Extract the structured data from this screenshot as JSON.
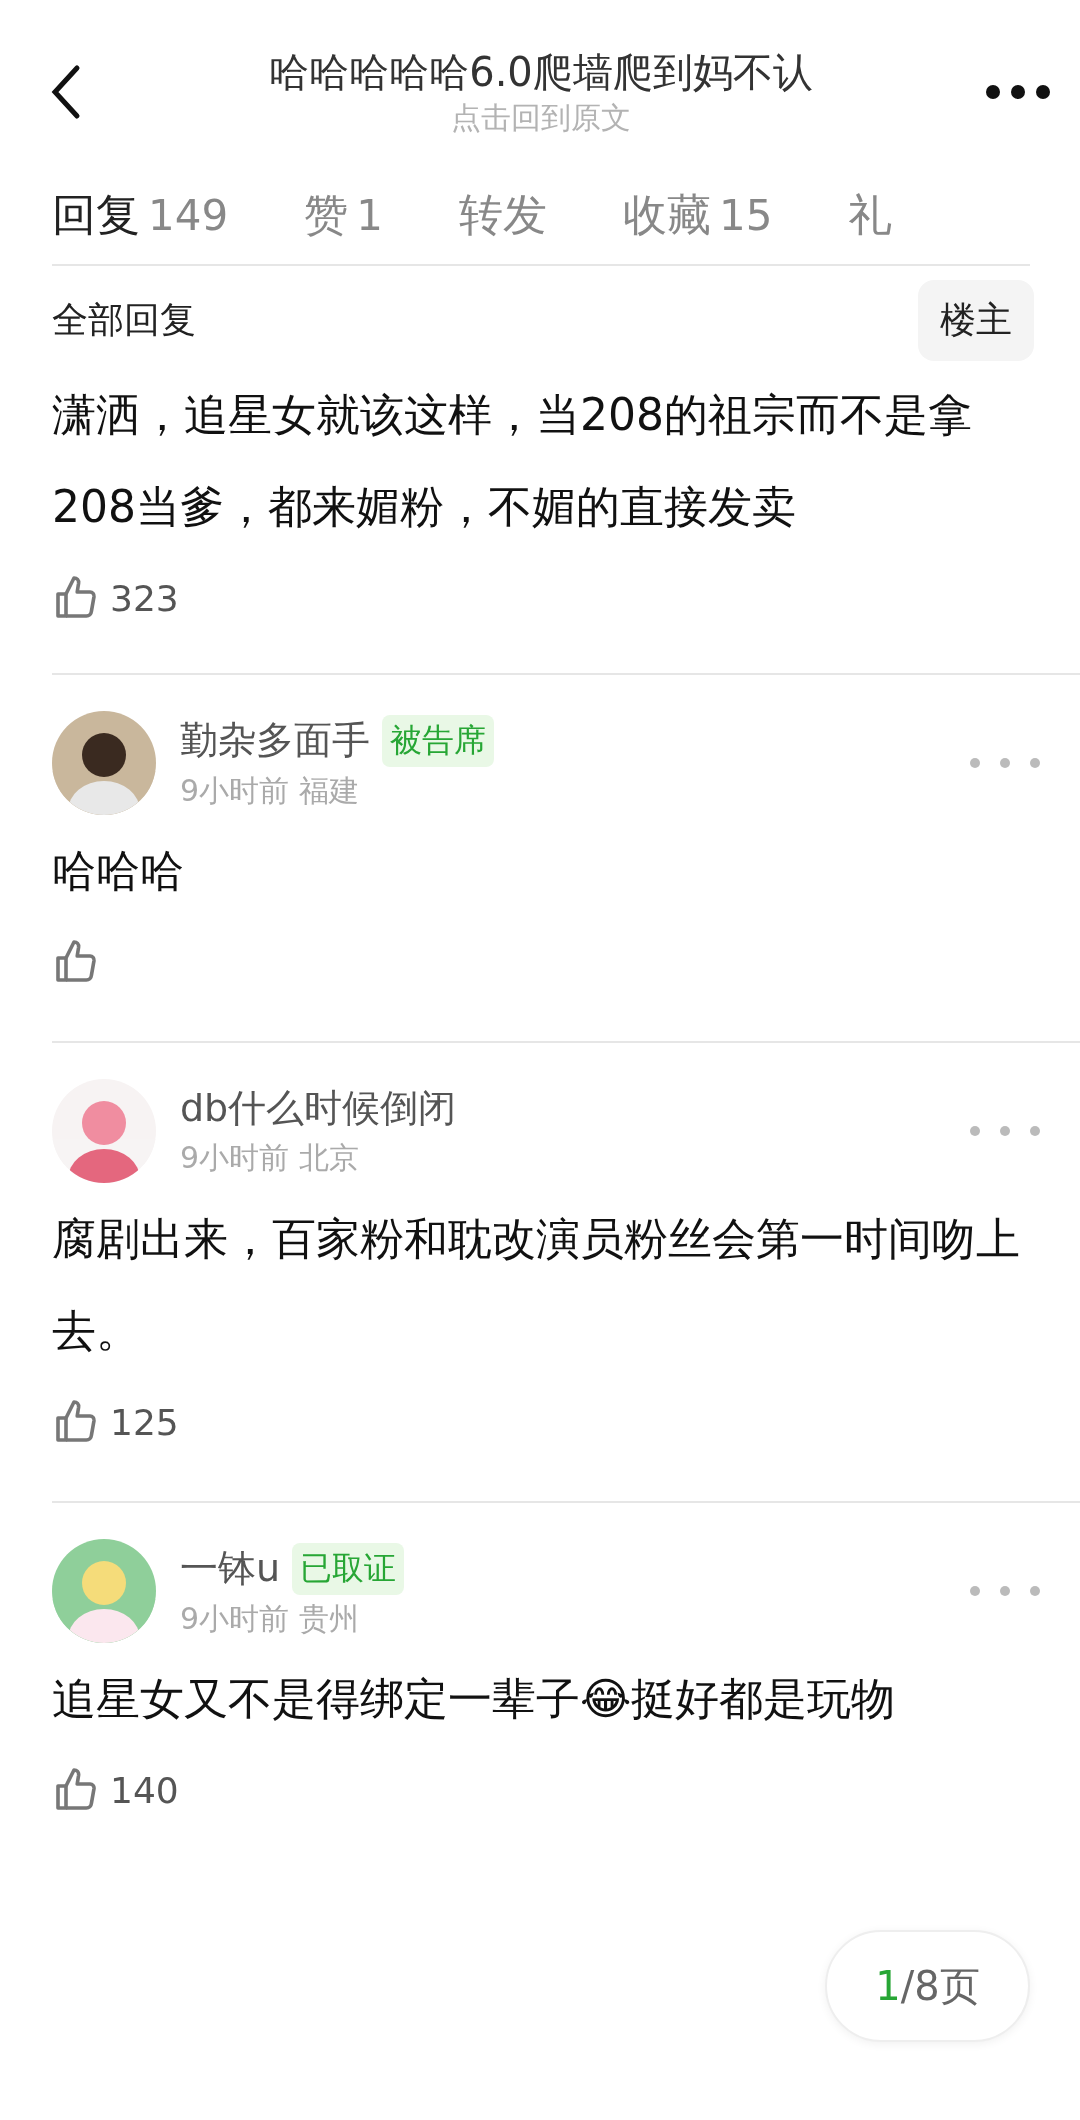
{
  "header": {
    "title": "哈哈哈哈哈6.0爬墙爬到妈不认",
    "subtitle": "点击回到原文"
  },
  "tabs": [
    {
      "label": "回复",
      "count": "149",
      "selected": true
    },
    {
      "label": "赞",
      "count": "1",
      "selected": false
    },
    {
      "label": "转发",
      "selected": false
    },
    {
      "label": "收藏",
      "count": "15",
      "selected": false
    },
    {
      "label": "礼",
      "selected": false
    }
  ],
  "section": {
    "title": "全部回复",
    "filter_button": "楼主"
  },
  "top_post": {
    "text": "潇洒，追星女就该这样，当208的祖宗而不是拿208当爹，都来媚粉，不媚的直接发卖",
    "likes": "323"
  },
  "comments": [
    {
      "user": "勤杂多面手",
      "badge": "被告席",
      "time": "9小时前",
      "location": "福建",
      "text": "哈哈哈"
    },
    {
      "user": "db什么时候倒闭",
      "time": "9小时前",
      "location": "北京",
      "text": "腐剧出来，百家粉和耽改演员粉丝会第一时间吻上去。",
      "likes": "125"
    },
    {
      "user": "一钵u",
      "badge": "已取证",
      "time": "9小时前",
      "location": "贵州",
      "text": "追星女又不是得绑定一辈子😂挺好都是玩物",
      "likes": "140"
    }
  ],
  "pager": {
    "current": "1",
    "total": "/8页"
  }
}
